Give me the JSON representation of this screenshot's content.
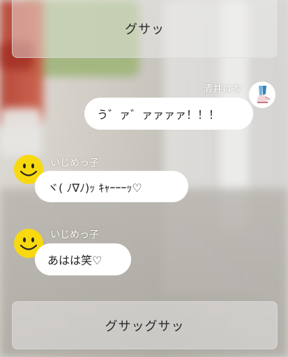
{
  "top_button": {
    "label": "グサッ"
  },
  "bottom_button": {
    "label": "グサッグサッ"
  },
  "messages": [
    {
      "sender": "清井はな",
      "text": "う゛ァ゛ァァァァ！！！",
      "side": "right",
      "avatar": "user-photo-avatar"
    },
    {
      "sender": "いじめっ子",
      "text": "ヾ( ﾉ∇ﾉ)ｯ ｷｬｰｰｰｯ♡",
      "side": "left",
      "avatar": "smiley-face-icon"
    },
    {
      "sender": "いじめっ子",
      "text": "あはは笑♡",
      "side": "left",
      "avatar": "smiley-face-icon"
    }
  ],
  "colors": {
    "bubble": "#ffffff",
    "smiley": "#f8d90f",
    "name_text": "#ffffff"
  }
}
